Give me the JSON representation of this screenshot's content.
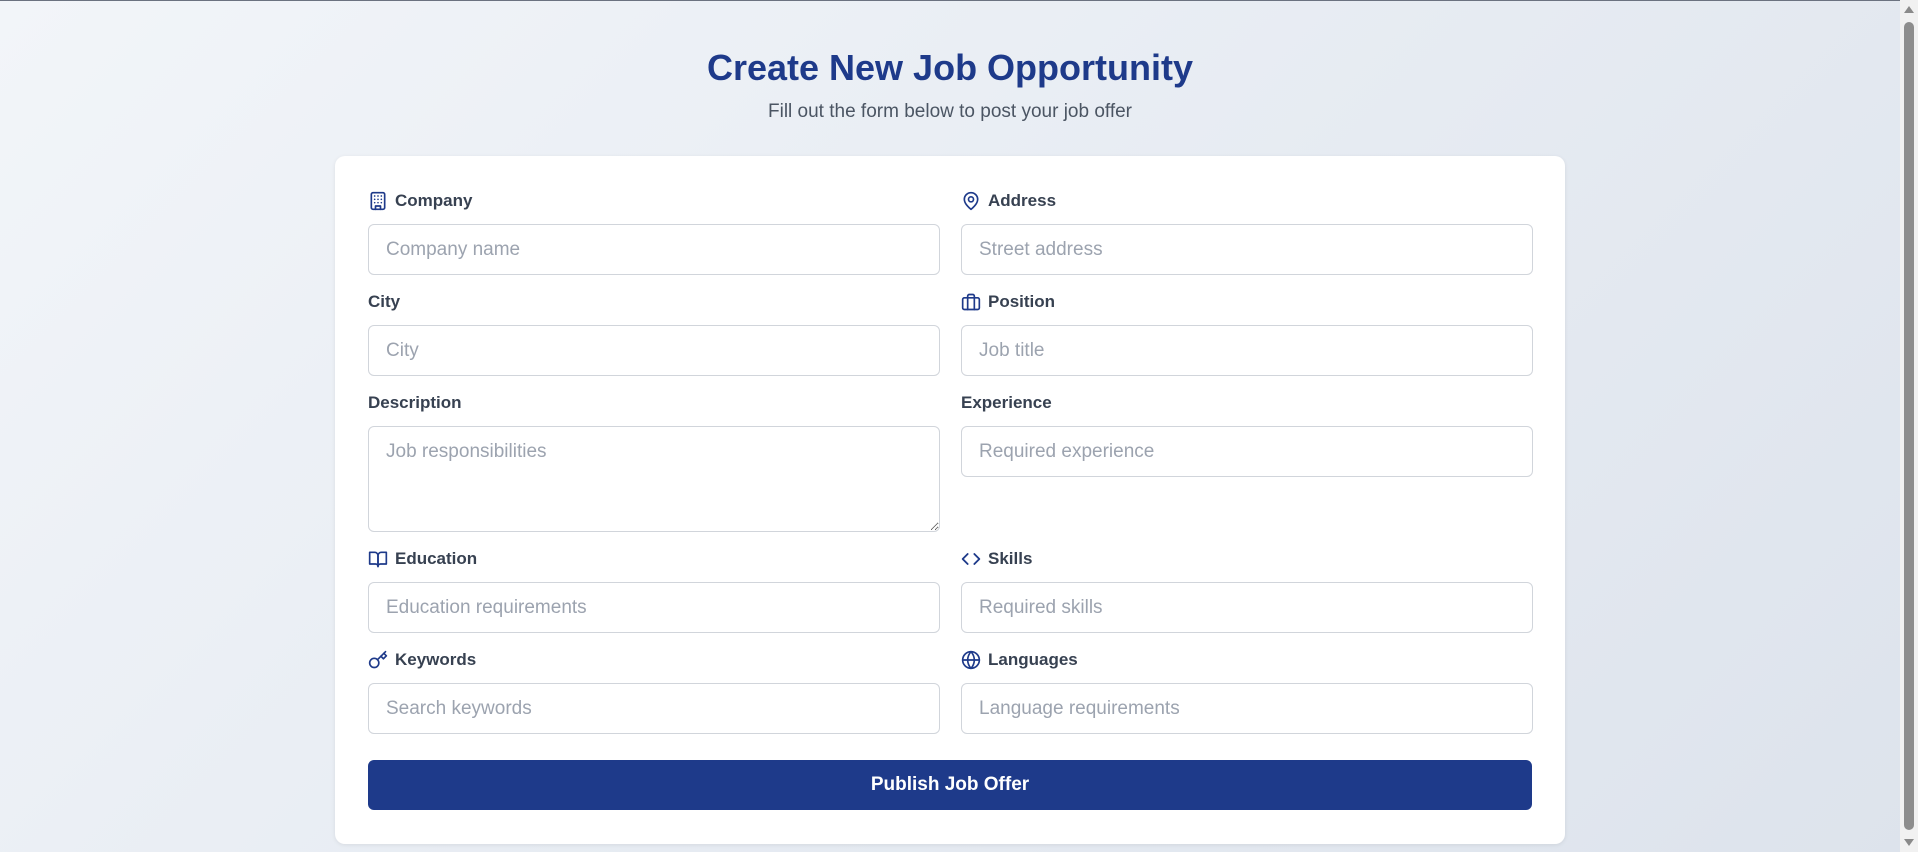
{
  "header": {
    "title": "Create New Job Opportunity",
    "subtitle": "Fill out the form below to post your job offer"
  },
  "form": {
    "company": {
      "label": "Company",
      "placeholder": "Company name",
      "value": "",
      "icon": "building-icon"
    },
    "address": {
      "label": "Address",
      "placeholder": "Street address",
      "value": "",
      "icon": "map-pin-icon"
    },
    "city": {
      "label": "City",
      "placeholder": "City",
      "value": ""
    },
    "position": {
      "label": "Position",
      "placeholder": "Job title",
      "value": "",
      "icon": "briefcase-icon"
    },
    "description": {
      "label": "Description",
      "placeholder": "Job responsibilities",
      "value": ""
    },
    "experience": {
      "label": "Experience",
      "placeholder": "Required experience",
      "value": ""
    },
    "education": {
      "label": "Education",
      "placeholder": "Education requirements",
      "value": "",
      "icon": "book-icon"
    },
    "skills": {
      "label": "Skills",
      "placeholder": "Required skills",
      "value": "",
      "icon": "code-icon"
    },
    "keywords": {
      "label": "Keywords",
      "placeholder": "Search keywords",
      "value": "",
      "icon": "key-icon"
    },
    "languages": {
      "label": "Languages",
      "placeholder": "Language requirements",
      "value": "",
      "icon": "globe-icon"
    },
    "submit_label": "Publish Job Offer"
  },
  "colors": {
    "accent": "#1e3a8a",
    "label_text": "#374151",
    "placeholder": "#9ca3af",
    "border": "#d1d5db"
  }
}
